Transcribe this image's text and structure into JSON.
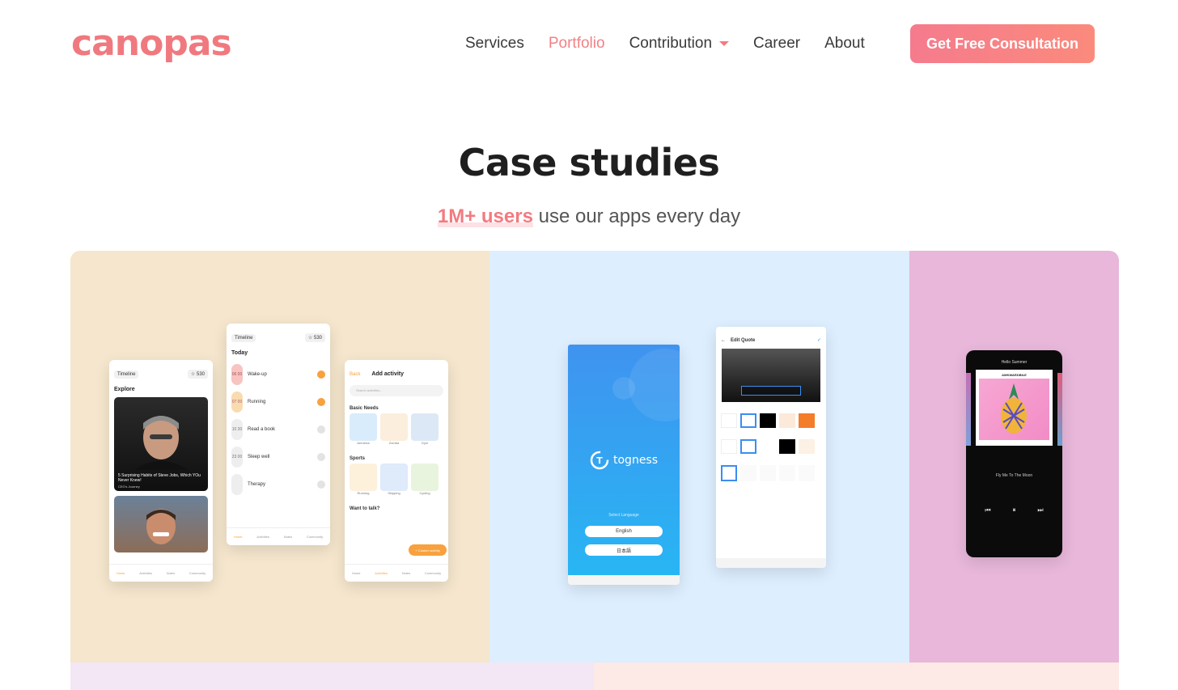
{
  "brand": {
    "logo_text": "canopas"
  },
  "nav": {
    "items": [
      {
        "label": "Services",
        "active": false
      },
      {
        "label": "Portfolio",
        "active": true
      },
      {
        "label": "Contribution",
        "active": false,
        "dropdown": true
      },
      {
        "label": "Career",
        "active": false
      },
      {
        "label": "About",
        "active": false
      }
    ],
    "cta_label": "Get Free Consultation"
  },
  "hero": {
    "title": "Case studies",
    "subtitle_highlight": "1M+ users",
    "subtitle_rest": " use our apps every day"
  },
  "cards": {
    "card1": {
      "timeline_label": "Timeline",
      "streak": "530",
      "explore_label": "Explore",
      "article_title": "5 Surprising Habits of Steve Jobs, Which YOu Never Knew!",
      "article_source": "CEO's Journey",
      "today_label": "Today",
      "tasks": [
        {
          "time": "06 00",
          "title": "Wake-up",
          "done": true
        },
        {
          "time": "07 00",
          "title": "Running",
          "done": true
        },
        {
          "time": "10 30",
          "title": "Read a book",
          "done": false
        },
        {
          "time": "23 00",
          "title": "Sleep well",
          "done": false
        },
        {
          "time": "",
          "title": "Therapy",
          "done": false
        }
      ],
      "add_activity_label": "Add activity",
      "back_label": "Back",
      "search_placeholder": "Search activities...",
      "section_basic": "Basic Needs",
      "basic_items": [
        "Aerobics",
        "Zumba",
        "Gym"
      ],
      "section_sports": "Sports",
      "sports_items": [
        "Running",
        "Skipping",
        "Cycling"
      ],
      "section_talk": "Want to talk?",
      "custom_activity": "+ Custom activity",
      "tabs": [
        "Home",
        "Activities",
        "Notes",
        "Community"
      ]
    },
    "card2": {
      "app_name": "togness",
      "select_language": "Select Language",
      "lang_1": "English",
      "lang_2": "日本語",
      "editor_title": "Edit Quote"
    },
    "card3": {
      "song_header": "Hello Summer",
      "album": "AWKWARDBILE",
      "track": "Fly Me To The Moon"
    }
  }
}
